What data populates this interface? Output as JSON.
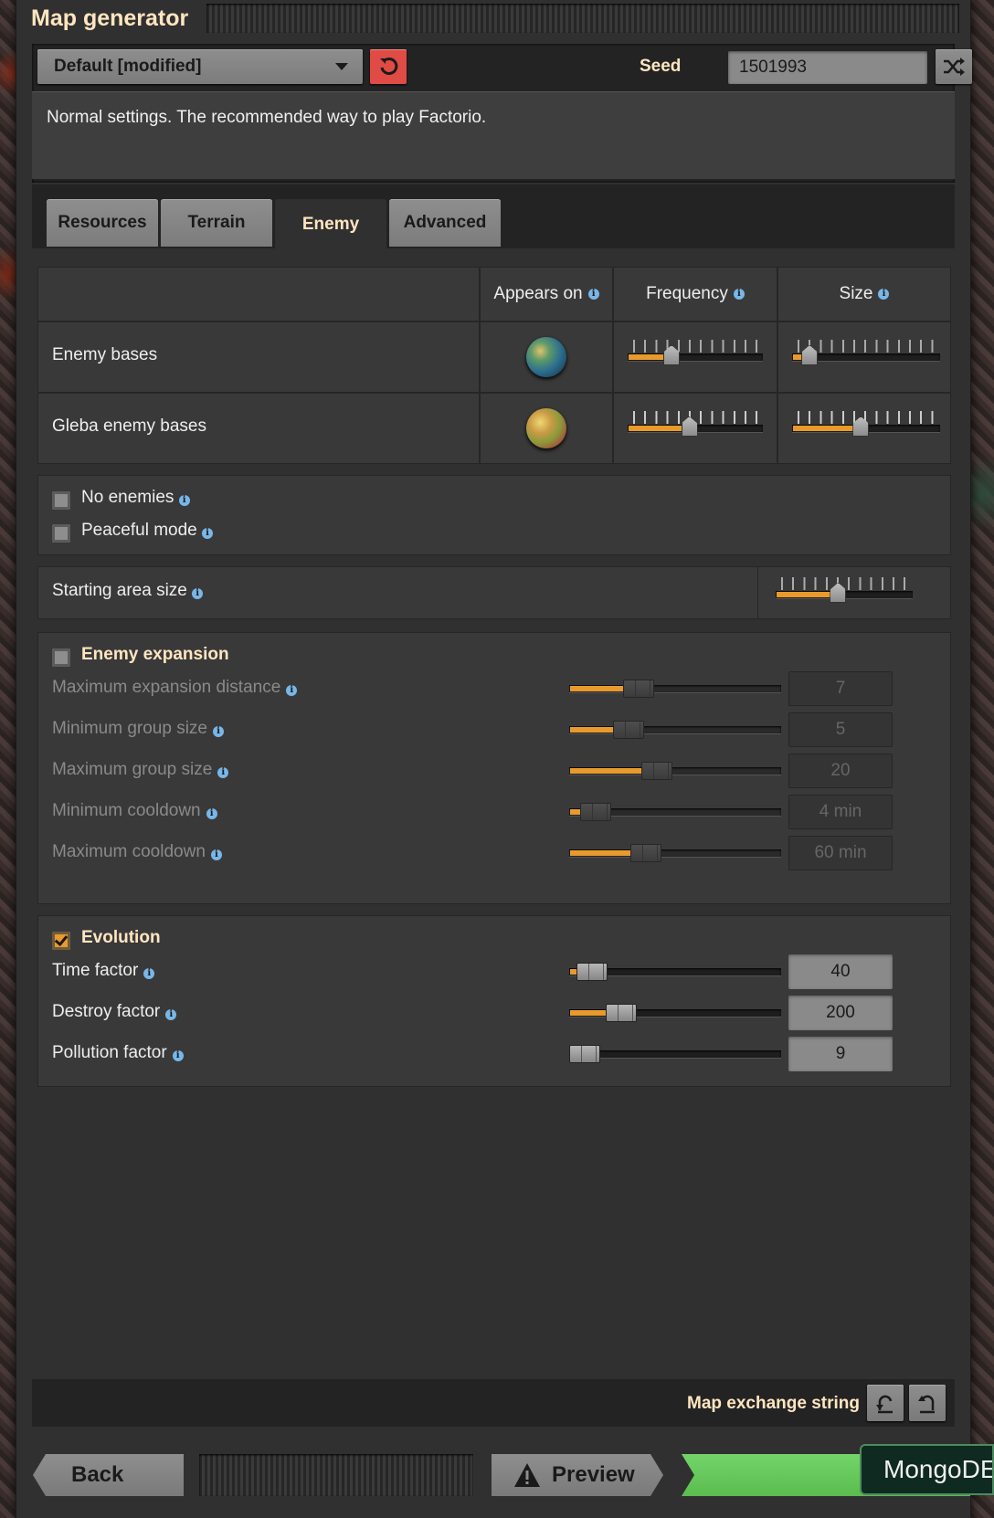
{
  "window": {
    "title": "Map generator"
  },
  "preset": {
    "selected": "Default [modified]"
  },
  "seed": {
    "label": "Seed",
    "value": "1501993"
  },
  "description": "Normal settings. The recommended way to play Factorio.",
  "tabs": [
    {
      "label": "Resources",
      "active": false
    },
    {
      "label": "Terrain",
      "active": false
    },
    {
      "label": "Enemy",
      "active": true
    },
    {
      "label": "Advanced",
      "active": false
    }
  ],
  "enemy_table": {
    "headers": {
      "appears_on": "Appears on",
      "frequency": "Frequency",
      "size": "Size"
    },
    "rows": [
      {
        "label": "Enemy bases",
        "planet": "nauvis-planet-icon",
        "frequency_level": 0.3,
        "size_level": 0.07
      },
      {
        "label": "Gleba enemy bases",
        "planet": "gleba-planet-icon",
        "frequency_level": 0.45,
        "size_level": 0.46
      }
    ]
  },
  "options": {
    "no_enemies": {
      "label": "No enemies",
      "checked": false
    },
    "peaceful_mode": {
      "label": "Peaceful mode",
      "checked": false
    }
  },
  "starting_area": {
    "label": "Starting area size",
    "level": 0.45
  },
  "expansion": {
    "title": "Enemy expansion",
    "enabled": false,
    "rows": [
      {
        "label": "Maximum expansion distance",
        "value": "7",
        "level": 0.3
      },
      {
        "label": "Minimum group size",
        "value": "5",
        "level": 0.24
      },
      {
        "label": "Maximum group size",
        "value": "20",
        "level": 0.4
      },
      {
        "label": "Minimum cooldown",
        "value": "4 min",
        "level": 0.06
      },
      {
        "label": "Maximum cooldown",
        "value": "60 min",
        "level": 0.34
      }
    ]
  },
  "evolution": {
    "title": "Evolution",
    "enabled": true,
    "rows": [
      {
        "label": "Time factor",
        "value": "40",
        "level": 0.04
      },
      {
        "label": "Destroy factor",
        "value": "200",
        "level": 0.2
      },
      {
        "label": "Pollution factor",
        "value": "9",
        "level": 0.0
      }
    ]
  },
  "exchange": {
    "label": "Map exchange string"
  },
  "footer": {
    "back": "Back",
    "preview": "Preview",
    "overlay_text": "MongoDE"
  },
  "colors": {
    "accent_orange": "#e89a2c",
    "reset_red": "#e04b45",
    "play_green": "#5abd4f",
    "title_cream": "#ffe6c0",
    "info_blue": "#78b7e8"
  }
}
